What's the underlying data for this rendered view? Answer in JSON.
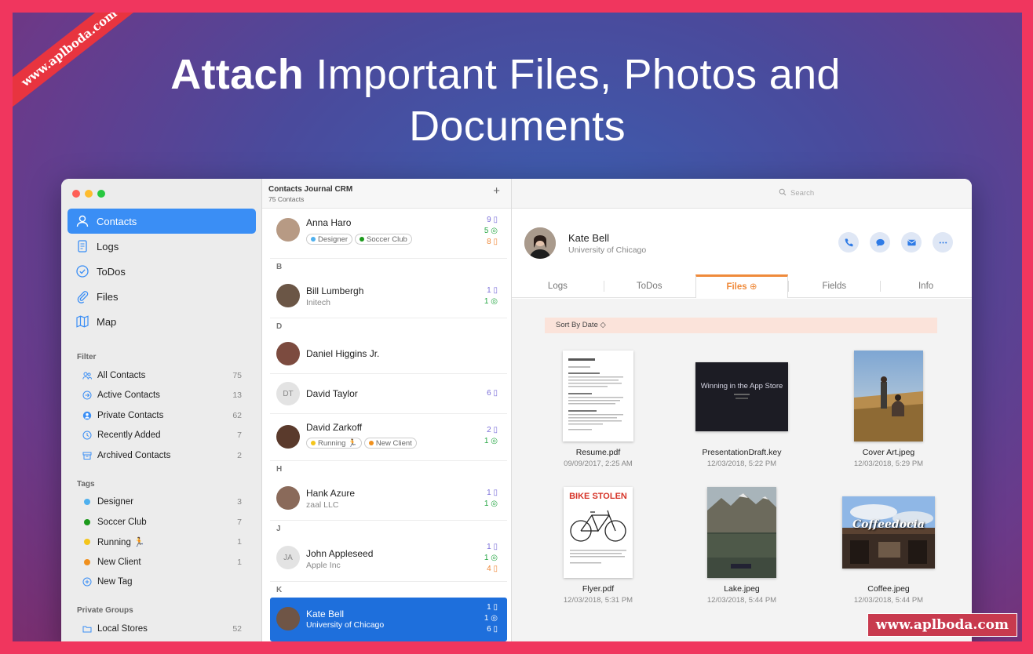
{
  "promo": {
    "headline_bold": "Attach",
    "headline_rest_line1": "Important Files, Photos and",
    "headline_line2": "Documents",
    "ribbon_text": "www.aplboda.com",
    "watermark_text": "www.aplboda.com"
  },
  "colors": {
    "accent": "#3a8ef5",
    "selected": "#1e6fdc",
    "orange": "#ef8a3b",
    "green": "#27a745",
    "purple": "#7b6fd9"
  },
  "sidebar": {
    "nav": [
      {
        "label": "Contacts",
        "icon": "person-icon",
        "active": true
      },
      {
        "label": "Logs",
        "icon": "document-icon"
      },
      {
        "label": "ToDos",
        "icon": "checkmark-circle-icon"
      },
      {
        "label": "Files",
        "icon": "paperclip-icon"
      },
      {
        "label": "Map",
        "icon": "map-icon"
      }
    ],
    "filter_title": "Filter",
    "filters": [
      {
        "label": "All Contacts",
        "count": "75",
        "icon": "people-icon"
      },
      {
        "label": "Active Contacts",
        "count": "13",
        "icon": "arrow-circle-icon"
      },
      {
        "label": "Private Contacts",
        "count": "62",
        "icon": "person-circle-icon"
      },
      {
        "label": "Recently Added",
        "count": "7",
        "icon": "clock-icon"
      },
      {
        "label": "Archived Contacts",
        "count": "2",
        "icon": "archive-icon"
      }
    ],
    "tags_title": "Tags",
    "tags": [
      {
        "label": "Designer",
        "count": "3",
        "color": "#4fb0ee"
      },
      {
        "label": "Soccer Club",
        "count": "7",
        "color": "#1c9a1c"
      },
      {
        "label": "Running 🏃",
        "count": "1",
        "color": "#f4c51c"
      },
      {
        "label": "New Client",
        "count": "1",
        "color": "#f0901e"
      }
    ],
    "new_tag": "New Tag",
    "groups_title": "Private Groups",
    "groups": [
      {
        "label": "Local Stores",
        "count": "52"
      }
    ]
  },
  "list": {
    "title": "Contacts Journal CRM",
    "subtitle": "75 Contacts",
    "add": "+",
    "letters": {
      "b": "B",
      "d": "D",
      "h": "H",
      "j": "J",
      "k": "K"
    },
    "contacts": [
      {
        "name": "Anna Haro",
        "tags": [
          {
            "label": "Designer",
            "color": "#4fb0ee"
          },
          {
            "label": "Soccer Club",
            "color": "#1c9a1c"
          }
        ],
        "counts": [
          "9",
          "5",
          "8"
        ]
      },
      {
        "name": "Bill Lumbergh",
        "sub": "Initech",
        "counts": [
          "1",
          "1"
        ]
      },
      {
        "name": "Daniel Higgins Jr."
      },
      {
        "name": "David Taylor",
        "initials": "DT",
        "counts": [
          "6"
        ]
      },
      {
        "name": "David Zarkoff",
        "tags": [
          {
            "label": "Running 🏃",
            "color": "#f4c51c"
          },
          {
            "label": "New Client",
            "color": "#f0901e"
          }
        ],
        "counts": [
          "2",
          "1"
        ]
      },
      {
        "name": "Hank Azure",
        "sub": "zaal LLC",
        "counts": [
          "1",
          "1"
        ]
      },
      {
        "name": "John Appleseed",
        "sub": "Apple Inc",
        "initials": "JA",
        "counts": [
          "1",
          "1",
          "4"
        ]
      },
      {
        "name": "Kate Bell",
        "sub": "University of Chicago",
        "counts": [
          "1",
          "1",
          "6"
        ]
      }
    ]
  },
  "detail": {
    "search_placeholder": "Search",
    "name": "Kate Bell",
    "org": "University of Chicago",
    "tabs": [
      "Logs",
      "ToDos",
      "Files",
      "Fields",
      "Info"
    ],
    "sort_label": "Sort By Date ◇",
    "files": [
      {
        "name": "Resume.pdf",
        "date": "09/09/2017, 2:25 AM"
      },
      {
        "name": "PresentationDraft.key",
        "date": "12/03/2018, 5:22 PM",
        "thumb_title": "Winning in the App Store"
      },
      {
        "name": "Cover Art.jpeg",
        "date": "12/03/2018, 5:29 PM"
      },
      {
        "name": "Flyer.pdf",
        "date": "12/03/2018, 5:31 PM",
        "thumb_title": "BIKE STOLEN"
      },
      {
        "name": "Lake.jpeg",
        "date": "12/03/2018, 5:44 PM"
      },
      {
        "name": "Coffee.jpeg",
        "date": "12/03/2018, 5:44 PM",
        "thumb_title": "Coffeedocia"
      }
    ]
  }
}
